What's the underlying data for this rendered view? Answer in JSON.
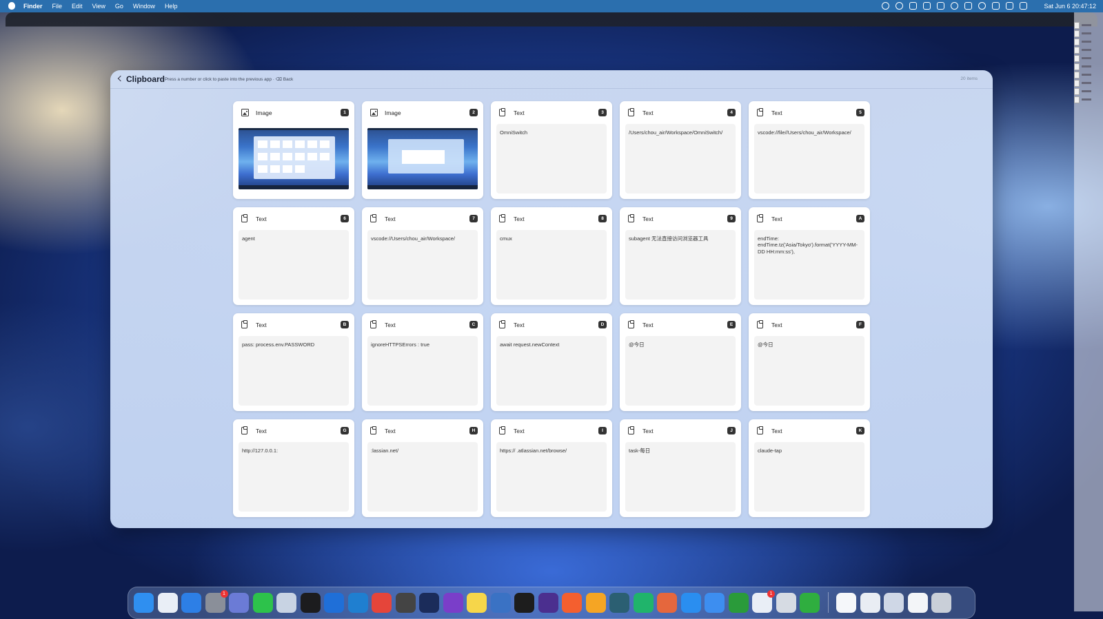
{
  "menubar": {
    "app_name": "Finder",
    "menus": [
      "File",
      "Edit",
      "View",
      "Go",
      "Window",
      "Help"
    ],
    "clock": "Sat Jun 6  20:47:12"
  },
  "panel": {
    "title": "Clipboard",
    "hint": "· Press a number or click to paste into the previous app · ⌫ Back",
    "count": "20 items"
  },
  "cards": [
    {
      "type": "Image",
      "key": "1",
      "content": "",
      "icon": "image-icon"
    },
    {
      "type": "Image",
      "key": "2",
      "content": "",
      "icon": "image-icon"
    },
    {
      "type": "Text",
      "key": "3",
      "content": "OmniSwitch",
      "icon": "clipboard-icon"
    },
    {
      "type": "Text",
      "key": "4",
      "content": "/Users/chou_air/Workspace/OmniSwitch/",
      "icon": "clipboard-icon"
    },
    {
      "type": "Text",
      "key": "5",
      "content": "vscode://file//Users/chou_air/Workspace/",
      "icon": "clipboard-icon"
    },
    {
      "type": "Text",
      "key": "6",
      "content": "agent",
      "icon": "clipboard-icon"
    },
    {
      "type": "Text",
      "key": "7",
      "content": "vscode://Users/chou_air/Workspace/",
      "icon": "clipboard-icon"
    },
    {
      "type": "Text",
      "key": "8",
      "content": "cmux",
      "icon": "clipboard-icon"
    },
    {
      "type": "Text",
      "key": "9",
      "content": "subagent 无法直接访问浏览器工具",
      "icon": "clipboard-icon"
    },
    {
      "type": "Text",
      "key": "A",
      "content": "endTime: endTime.tz('Asia/Tokyo').format('YYYY-MM-DD HH:mm:ss'),",
      "icon": "clipboard-icon"
    },
    {
      "type": "Text",
      "key": "B",
      "content": "pass: process.env.PASSWORD",
      "icon": "clipboard-icon"
    },
    {
      "type": "Text",
      "key": "C",
      "content": "ignoreHTTPSErrors : true",
      "icon": "clipboard-icon"
    },
    {
      "type": "Text",
      "key": "D",
      "content": "await request.newContext",
      "icon": "clipboard-icon"
    },
    {
      "type": "Text",
      "key": "E",
      "content": "@今日",
      "icon": "clipboard-icon"
    },
    {
      "type": "Text",
      "key": "F",
      "content": "@今日",
      "icon": "clipboard-icon"
    },
    {
      "type": "Text",
      "key": "G",
      "content": "http://127.0.0.1:",
      "icon": "clipboard-icon"
    },
    {
      "type": "Text",
      "key": "H",
      "content": ":lassian.net/",
      "icon": "clipboard-icon"
    },
    {
      "type": "Text",
      "key": "I",
      "content": "https://      .atlassian.net/browse/",
      "icon": "clipboard-icon"
    },
    {
      "type": "Text",
      "key": "J",
      "content": "task-每日",
      "icon": "clipboard-icon"
    },
    {
      "type": "Text",
      "key": "K",
      "content": "claude-tap",
      "icon": "clipboard-icon"
    }
  ],
  "dock": {
    "apps": [
      {
        "name": "finder-icon",
        "color": "#2f8ff0"
      },
      {
        "name": "launchpad-icon",
        "color": "#e9eef6"
      },
      {
        "name": "safari-icon",
        "color": "#2d7fe6"
      },
      {
        "name": "system-settings-icon",
        "color": "#8a8f99",
        "badge": "1"
      },
      {
        "name": "iphone-mirroring-icon",
        "color": "#6b7bd6"
      },
      {
        "name": "wechat-icon",
        "color": "#2dc24b"
      },
      {
        "name": "preview-icon",
        "color": "#c8d3e3"
      },
      {
        "name": "grid-app-icon",
        "color": "#1c1c1e"
      },
      {
        "name": "xcode-icon",
        "color": "#1f6fd8"
      },
      {
        "name": "vscode-icon",
        "color": "#1f7fd0"
      },
      {
        "name": "chrome-icon",
        "color": "#e5453a"
      },
      {
        "name": "cursor-icon",
        "color": "#444"
      },
      {
        "name": "terminal-icon",
        "color": "#1b2c5a"
      },
      {
        "name": "github-desktop-icon",
        "color": "#7a3ec9"
      },
      {
        "name": "notes-icon",
        "color": "#f6d64a"
      },
      {
        "name": "tableplus-icon",
        "color": "#3a72c4"
      },
      {
        "name": "datagrip-icon",
        "color": "#1d1d1d"
      },
      {
        "name": "obsidian-icon",
        "color": "#4b2f8f"
      },
      {
        "name": "pencil-app-icon",
        "color": "#f45f2f"
      },
      {
        "name": "orange-app-icon",
        "color": "#f5a524"
      },
      {
        "name": "layers-app-icon",
        "color": "#2b5f72"
      },
      {
        "name": "pycharm-icon",
        "color": "#20b46b"
      },
      {
        "name": "claude-icon",
        "color": "#e5673d"
      },
      {
        "name": "app-store-icon",
        "color": "#2a8ef0"
      },
      {
        "name": "keynote-icon",
        "color": "#3d8ef0"
      },
      {
        "name": "numbers-icon",
        "color": "#2a9b3a"
      },
      {
        "name": "slack-icon",
        "color": "#e9eef6",
        "badge": "1"
      },
      {
        "name": "xcode-instruments-icon",
        "color": "#d6dbe3"
      },
      {
        "name": "evernote-icon",
        "color": "#2fae3f"
      }
    ],
    "extras": [
      {
        "name": "minimized-window-icon",
        "color": "#f5f7fa"
      },
      {
        "name": "documents-stack-icon",
        "color": "#e9edf3"
      },
      {
        "name": "screenshots-stack-icon",
        "color": "#cfd7e6"
      },
      {
        "name": "downloads-stack-icon",
        "color": "#f3f5f8"
      },
      {
        "name": "trash-icon",
        "color": "#c9cfd8"
      }
    ]
  }
}
